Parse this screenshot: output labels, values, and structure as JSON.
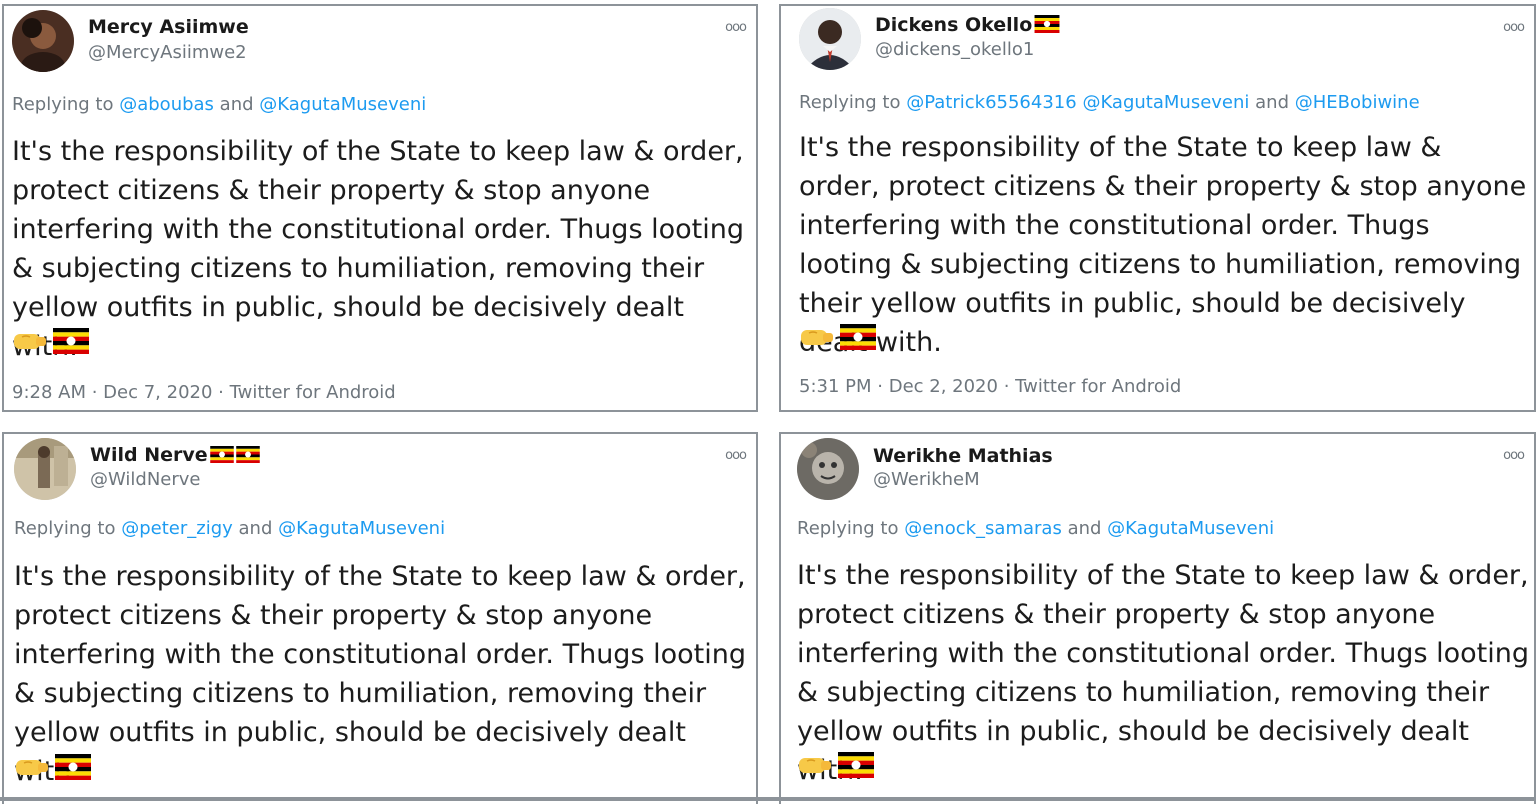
{
  "tweets": [
    {
      "display_name": "Mercy Asiimwe",
      "handle": "@MercyAsiimwe2",
      "reply_prefix": "Replying to",
      "mention_1": "@aboubas",
      "joiner": "and",
      "mention_2": "@KagutaMuseveni",
      "text": "It's the responsibility of the State to keep law & order, protect citizens & their property & stop anyone interfering with the constitutional order. Thugs looting & subjecting citizens to humiliation, removing their yellow outfits in public, should be decisively dealt with.",
      "time": "9:28 AM",
      "date": "Dec 7, 2020",
      "source": "Twitter for Android",
      "name_flags": 0
    },
    {
      "display_name": "Dickens Okello",
      "handle": "@dickens_okello1",
      "reply_prefix": "Replying to",
      "mention_1": "@Patrick65564316",
      "mention_1b": "@KagutaMuseveni",
      "joiner": "and",
      "mention_2": "@HEBobiwine",
      "text": "It's the responsibility of the State to keep law & order, protect citizens & their property & stop anyone interfering with the constitutional order. Thugs looting & subjecting citizens to humiliation, removing their yellow outfits in public, should be decisively dealt with.",
      "time": "5:31 PM",
      "date": "Dec 2, 2020",
      "source": "Twitter for Android",
      "name_flags": 1
    },
    {
      "display_name": "Wild Nerve",
      "handle": "@WildNerve",
      "reply_prefix": "Replying to",
      "mention_1": "@peter_zigy",
      "joiner": "and",
      "mention_2": "@KagutaMuseveni",
      "text": "It's the responsibility of the State to keep law & order, protect citizens & their property & stop anyone interfering with the constitutional order. Thugs looting & subjecting citizens to humiliation, removing their yellow outfits in public, should be decisively dealt with.",
      "name_flags": 2
    },
    {
      "display_name": "Werikhe Mathias",
      "handle": "@WerikheM",
      "reply_prefix": "Replying to",
      "mention_1": "@enock_samaras",
      "joiner": "and",
      "mention_2": "@KagutaMuseveni",
      "text": "It's the responsibility of the State to keep law & order, protect citizens & their property & stop anyone interfering with the constitutional order. Thugs looting & subjecting citizens to humiliation, removing their yellow outfits in public, should be decisively dealt with.",
      "name_flags": 0
    }
  ],
  "icons": {
    "more": "more-options-icon",
    "emoji_1": "fist-emoji",
    "emoji_2": "uganda-flag-emoji"
  },
  "colors": {
    "mention": "#1d9bf0",
    "muted": "#6e767d",
    "flag_black": "#000000",
    "flag_yellow": "#fcdc04",
    "flag_red": "#d90000",
    "fist": "#f7c948"
  }
}
